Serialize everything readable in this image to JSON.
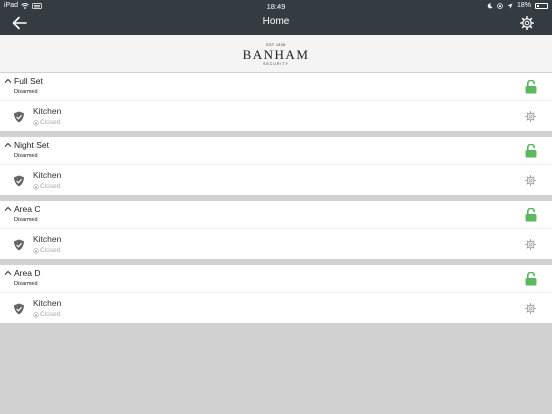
{
  "status_bar": {
    "carrier": "iPad",
    "time": "18:49",
    "battery": "18%",
    "battery_fraction": 0.18
  },
  "nav": {
    "title": "Home",
    "back_icon": "arrow-left-icon",
    "settings_icon": "gear-icon"
  },
  "logo": {
    "est": "EST 1926",
    "name": "BANHAM",
    "sub": "SECURITY"
  },
  "colors": {
    "nav_bg": "#343c42",
    "lock_green": "#5cb85c",
    "separator": "#d1d1d1"
  },
  "areas": [
    {
      "name": "Full Set",
      "status": "Disarmed",
      "zone": {
        "name": "Kitchen",
        "state": "Closed"
      }
    },
    {
      "name": "Night Set",
      "status": "Disarmed",
      "zone": {
        "name": "Kitchen",
        "state": "Closed"
      }
    },
    {
      "name": "Area C",
      "status": "Disarmed",
      "zone": {
        "name": "Kitchen",
        "state": "Closed"
      }
    },
    {
      "name": "Area D",
      "status": "Disarmed",
      "zone": {
        "name": "Kitchen",
        "state": "Closed"
      }
    }
  ]
}
